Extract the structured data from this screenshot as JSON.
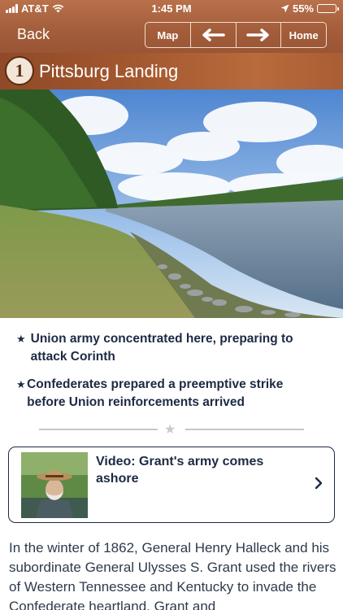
{
  "status": {
    "carrier": "AT&T",
    "time": "1:45 PM",
    "battery": "55%",
    "battery_level": 0.55
  },
  "nav": {
    "back": "Back",
    "map": "Map",
    "prev_icon": "arrow-left-icon",
    "next_icon": "arrow-right-icon",
    "home": "Home"
  },
  "stop": {
    "number": "1",
    "title": "Pittsburg Landing"
  },
  "bullets": [
    "Union army concentrated here, preparing to attack Corinth",
    "Confederates prepared a preemptive strike before Union reinforcements arrived"
  ],
  "video": {
    "title": "Video: Grant's army comes ashore"
  },
  "paragraph": "In the winter of 1862, General Henry Halleck and his subordinate General Ulysses S. Grant used the rivers of Western Tennessee and Kentucky to invade the Confederate heartland. Grant and",
  "colors": {
    "header": "#a45e3b",
    "title_band": "#a4582f",
    "navy": "#1d2a43"
  }
}
